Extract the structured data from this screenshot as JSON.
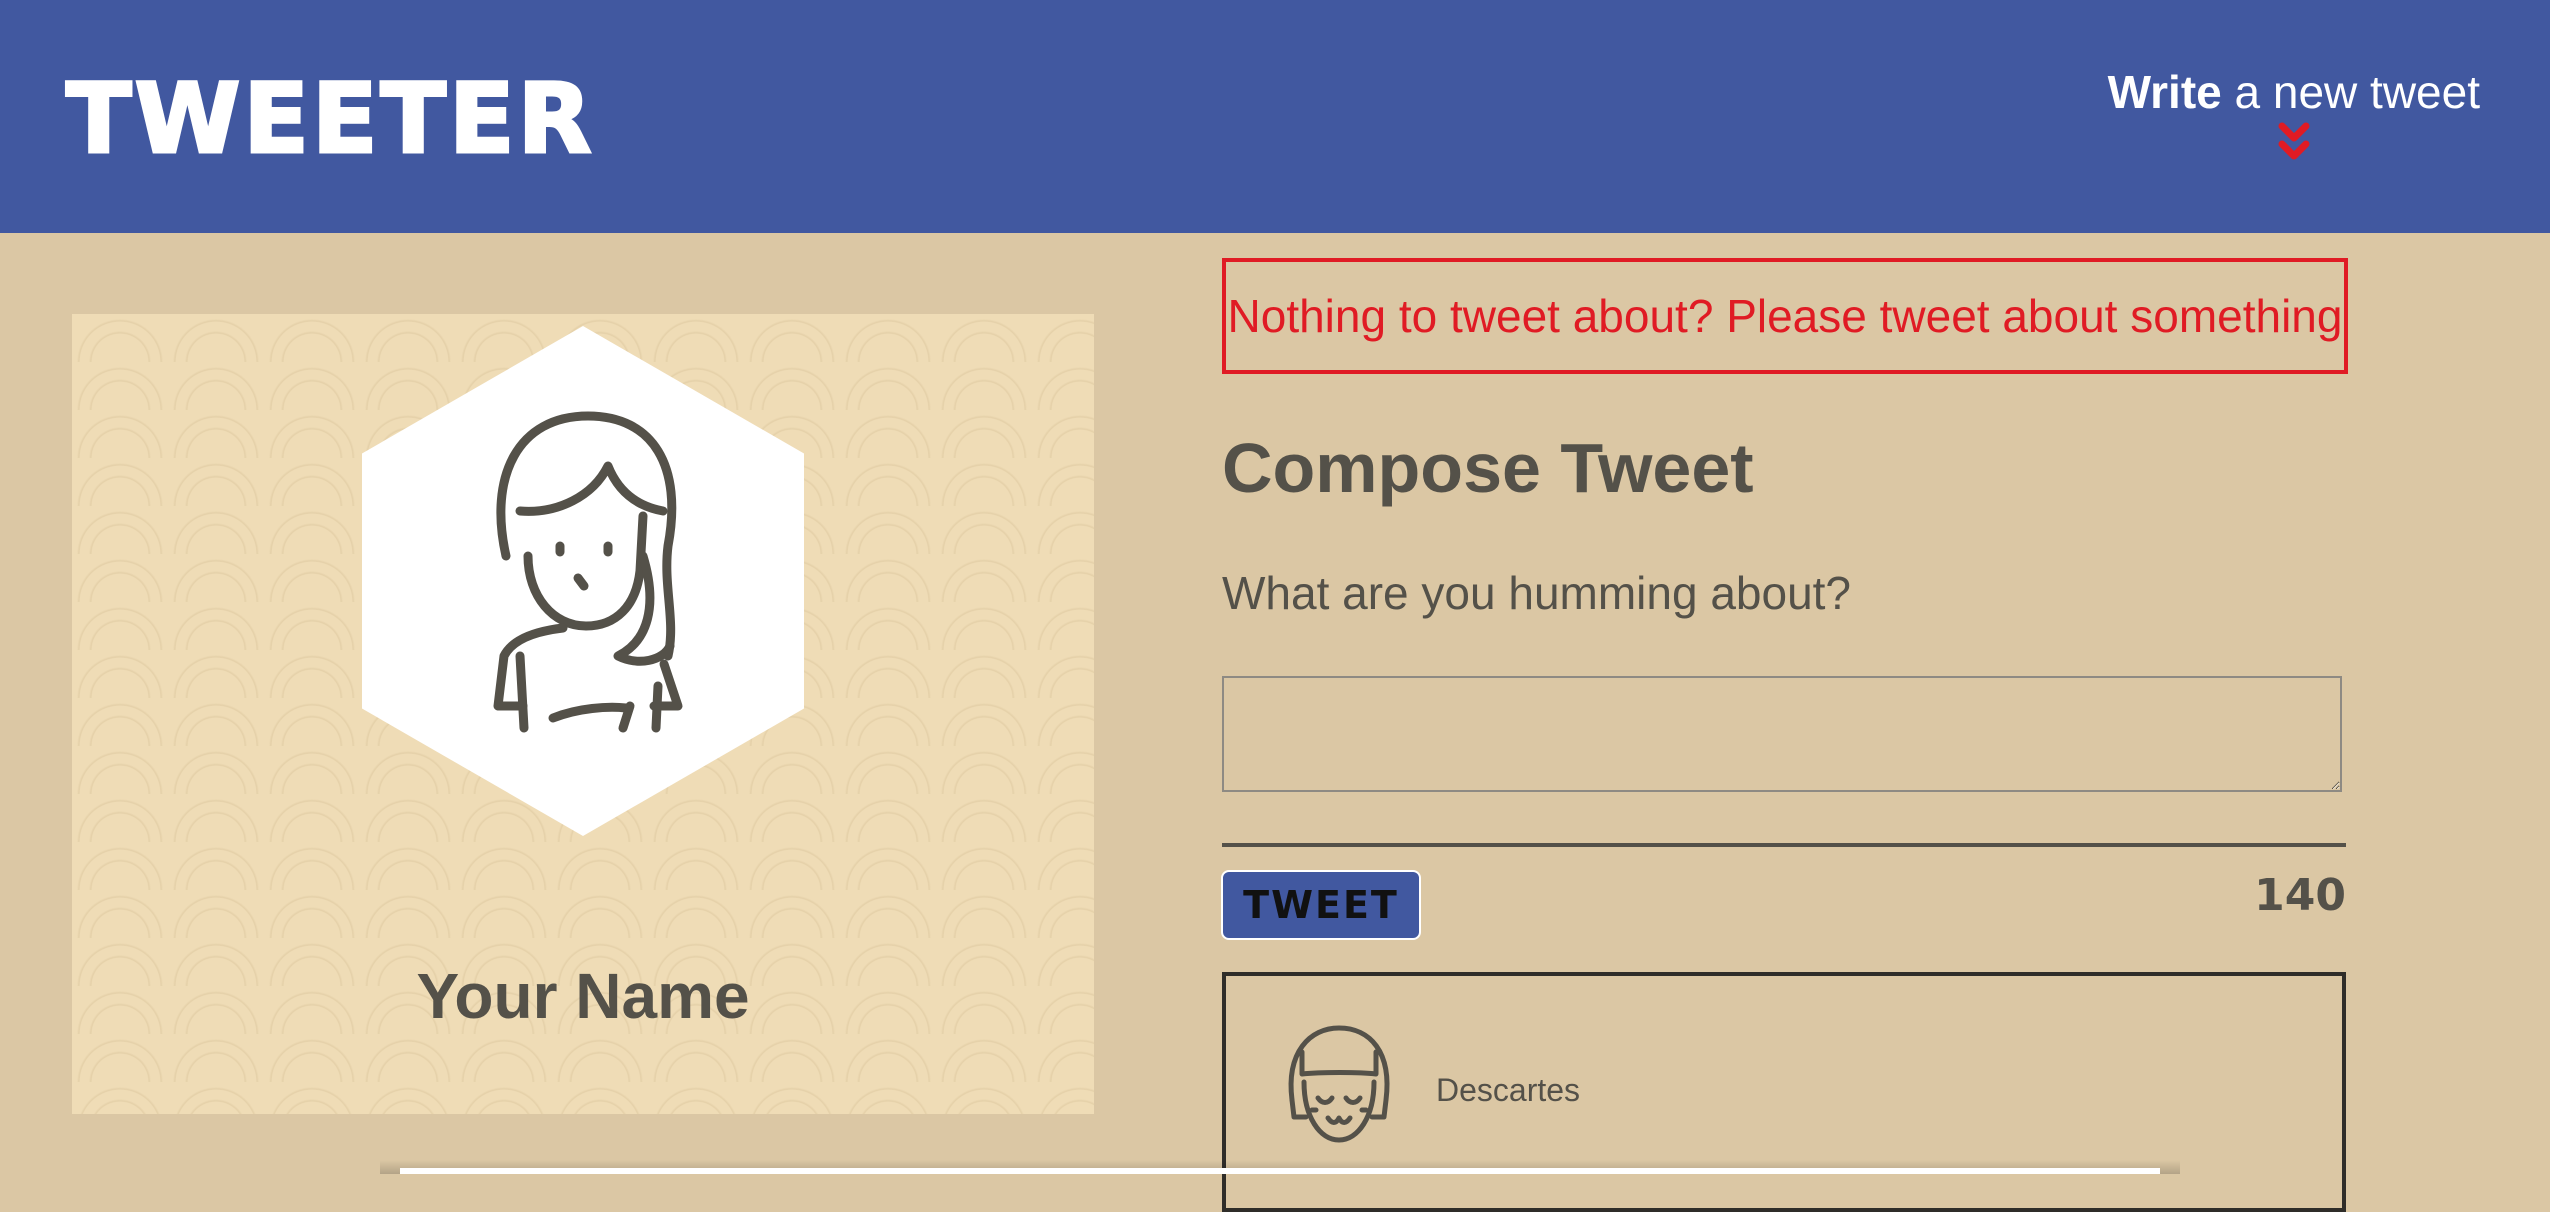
{
  "header": {
    "brand": "TWEETER",
    "write_bold": "Write",
    "write_rest": "a new tweet",
    "chevron_icon": "double-chevron-down-icon"
  },
  "profile": {
    "name": "Your Name",
    "avatar_icon": "woman-avatar-icon"
  },
  "compose": {
    "error_message": "Nothing to tweet about? Please tweet about something",
    "title": "Compose Tweet",
    "prompt": "What are you humming about?",
    "input_value": "",
    "button_label": "TWEET",
    "counter": "140"
  },
  "tweets": [
    {
      "author": "Descartes",
      "avatar_icon": "girl-avatar-icon"
    }
  ],
  "colors": {
    "header_bg": "#4158a0",
    "page_bg": "#dbc7a4",
    "accent_red": "#e01b24",
    "text": "#545149"
  }
}
